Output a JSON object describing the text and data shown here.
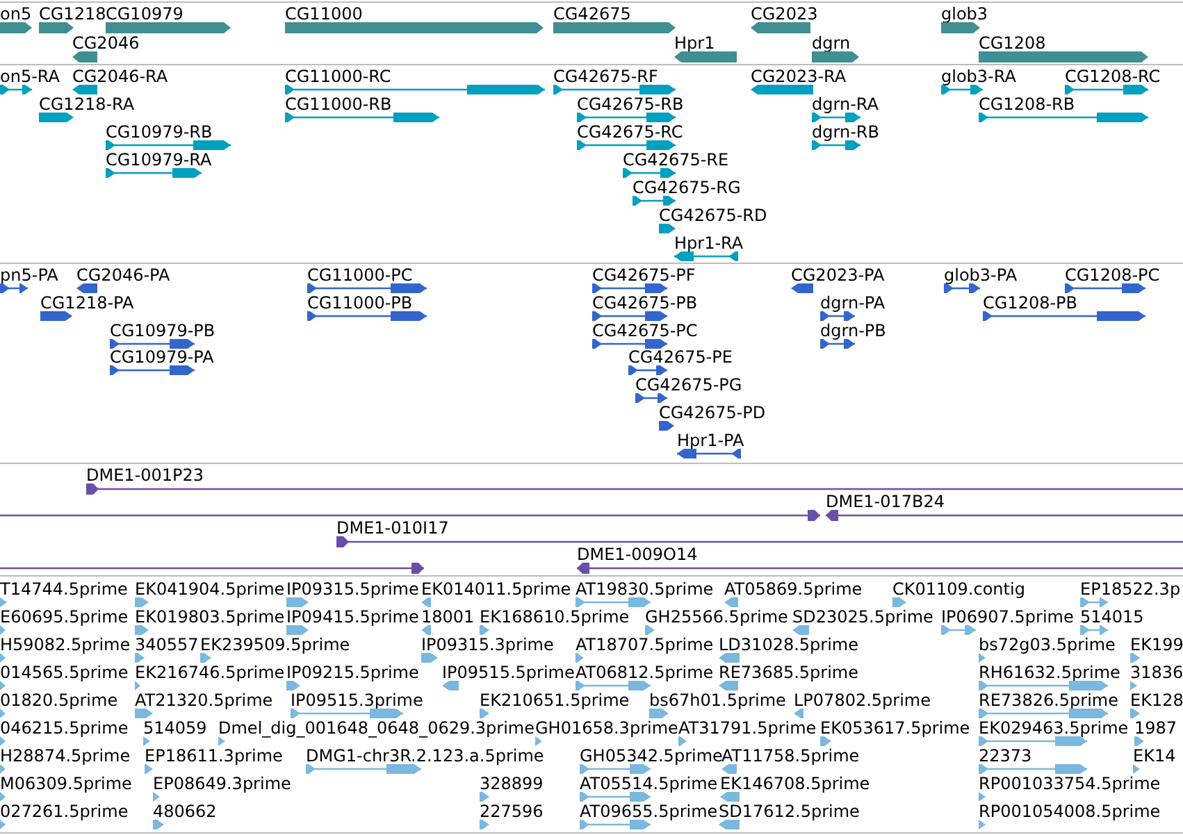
{
  "tracks": [
    {
      "kind": "gene",
      "features": [
        {
          "label": "on5",
          "reverse": false
        },
        {
          "label": "CG1218",
          "reverse": false
        },
        {
          "label": "CG10979",
          "reverse": false
        },
        {
          "label": "CG2046",
          "reverse": true
        },
        {
          "label": "CG11000",
          "reverse": false
        },
        {
          "label": "CG42675",
          "reverse": false
        },
        {
          "label": "Hpr1",
          "reverse": true
        },
        {
          "label": "CG2023",
          "reverse": true
        },
        {
          "label": "dgrn",
          "reverse": false
        },
        {
          "label": "glob3",
          "reverse": false
        },
        {
          "label": "CG1208",
          "reverse": false
        }
      ]
    },
    {
      "kind": "transcript",
      "features": [
        {
          "label": "on5-RA",
          "reverse": false
        },
        {
          "label": "CG2046-RA",
          "reverse": true
        },
        {
          "label": "CG1218-RA",
          "reverse": false
        },
        {
          "label": "CG10979-RB",
          "reverse": false
        },
        {
          "label": "CG10979-RA",
          "reverse": false
        },
        {
          "label": "CG11000-RC",
          "reverse": false
        },
        {
          "label": "CG11000-RB",
          "reverse": false
        },
        {
          "label": "CG42675-RF",
          "reverse": false
        },
        {
          "label": "CG42675-RB",
          "reverse": false
        },
        {
          "label": "CG42675-RC",
          "reverse": false
        },
        {
          "label": "CG42675-RE",
          "reverse": false
        },
        {
          "label": "CG42675-RG",
          "reverse": false
        },
        {
          "label": "CG42675-RD",
          "reverse": false
        },
        {
          "label": "Hpr1-RA",
          "reverse": true
        },
        {
          "label": "CG2023-RA",
          "reverse": true
        },
        {
          "label": "dgrn-RA",
          "reverse": false
        },
        {
          "label": "dgrn-RB",
          "reverse": false
        },
        {
          "label": "glob3-RA",
          "reverse": false
        },
        {
          "label": "CG1208-RC",
          "reverse": false
        },
        {
          "label": "CG1208-RB",
          "reverse": false
        }
      ]
    },
    {
      "kind": "protein",
      "features": [
        {
          "label": "pn5-PA",
          "reverse": false
        },
        {
          "label": "CG2046-PA",
          "reverse": true
        },
        {
          "label": "CG1218-PA",
          "reverse": false
        },
        {
          "label": "CG10979-PB",
          "reverse": false
        },
        {
          "label": "CG10979-PA",
          "reverse": false
        },
        {
          "label": "CG11000-PC",
          "reverse": false
        },
        {
          "label": "CG11000-PB",
          "reverse": false
        },
        {
          "label": "CG42675-PF",
          "reverse": false
        },
        {
          "label": "CG42675-PB",
          "reverse": false
        },
        {
          "label": "CG42675-PC",
          "reverse": false
        },
        {
          "label": "CG42675-PE",
          "reverse": false
        },
        {
          "label": "CG42675-PG",
          "reverse": false
        },
        {
          "label": "CG42675-PD",
          "reverse": false
        },
        {
          "label": "Hpr1-PA",
          "reverse": true
        },
        {
          "label": "CG2023-PA",
          "reverse": true
        },
        {
          "label": "dgrn-PA",
          "reverse": false
        },
        {
          "label": "dgrn-PB",
          "reverse": false
        },
        {
          "label": "glob3-PA",
          "reverse": false
        },
        {
          "label": "CG1208-PC",
          "reverse": false
        },
        {
          "label": "CG1208-PB",
          "reverse": false
        }
      ]
    },
    {
      "kind": "clone",
      "features": [
        {
          "label": "DME1-001P23",
          "reverse": false
        },
        {
          "reverse": false
        },
        {
          "label": "DME1-017B24",
          "reverse": true
        },
        {
          "label": "DME1-010I17",
          "reverse": false
        },
        {
          "reverse": false
        },
        {
          "label": "DME1-009O14",
          "reverse": true
        }
      ]
    },
    {
      "kind": "est",
      "features": [
        {
          "label": "T14744.5prime",
          "reverse": false
        },
        {
          "label": "EK041904.5prime",
          "reverse": false
        },
        {
          "label": "IP09315.5prime",
          "reverse": false
        },
        {
          "label": "EK014011.5prime",
          "reverse": true
        },
        {
          "label": "AT19830.5prime",
          "reverse": false
        },
        {
          "label": "AT05869.5prime",
          "reverse": true
        },
        {
          "label": "CK01109.contig",
          "reverse": false
        },
        {
          "label": "EP18522.3p",
          "reverse": false
        },
        {
          "label": "E60695.5prime",
          "reverse": false
        },
        {
          "label": "EK019803.5prime",
          "reverse": false
        },
        {
          "label": "IP09415.5prime",
          "reverse": false
        },
        {
          "label": "18001",
          "reverse": true
        },
        {
          "label": "EK168610.5prime",
          "reverse": false
        },
        {
          "label": "GH25566.5prime",
          "reverse": false
        },
        {
          "label": "SD23025.5prime",
          "reverse": true
        },
        {
          "label": "IP06907.5prime",
          "reverse": false
        },
        {
          "label": "514015",
          "reverse": false
        },
        {
          "label": "H59082.5prime",
          "reverse": false
        },
        {
          "label": "340557",
          "reverse": false
        },
        {
          "label": "EK239509.5prime",
          "reverse": false
        },
        {
          "label": "IP09315.3prime",
          "reverse": false
        },
        {
          "label": "AT18707.5prime",
          "reverse": false
        },
        {
          "label": "LD31028.5prime",
          "reverse": true
        },
        {
          "label": "bs72g03.5prime",
          "reverse": false
        },
        {
          "label": "EK199",
          "reverse": false
        },
        {
          "label": "014565.5prime",
          "reverse": false
        },
        {
          "label": "EK216746.5prime",
          "reverse": false
        },
        {
          "label": "IP09215.5prime",
          "reverse": false
        },
        {
          "label": "IP09515.5prime",
          "reverse": true
        },
        {
          "label": "AT06812.5prime",
          "reverse": false
        },
        {
          "label": "RE73685.5prime",
          "reverse": true
        },
        {
          "label": "RH61632.5prime",
          "reverse": false
        },
        {
          "label": "31836",
          "reverse": false
        },
        {
          "label": "01820.5prime",
          "reverse": false
        },
        {
          "label": "AT21320.5prime",
          "reverse": false
        },
        {
          "label": "IP09515.3prime",
          "reverse": false
        },
        {
          "label": "EK210651.5prime",
          "reverse": false
        },
        {
          "label": "bs67h01.5prime",
          "reverse": false
        },
        {
          "label": "LP07802.5prime",
          "reverse": true
        },
        {
          "label": "RE73826.5prime",
          "reverse": false
        },
        {
          "label": "EK128",
          "reverse": false
        },
        {
          "label": "046215.5prime",
          "reverse": false
        },
        {
          "label": "514059",
          "reverse": false
        },
        {
          "label": "Dmel_dig_001648_0648_0629.3prime",
          "reverse": false
        },
        {
          "label": "GH01658.3prime",
          "reverse": false
        },
        {
          "label": "AT31791.5prime",
          "reverse": false
        },
        {
          "label": "EK053617.5prime",
          "reverse": false
        },
        {
          "label": "EK029463.5prime",
          "reverse": false
        },
        {
          "label": "1987",
          "reverse": false
        },
        {
          "label": "H28874.5prime",
          "reverse": false
        },
        {
          "label": "EP18611.3prime",
          "reverse": false
        },
        {
          "label": "DMG1-chr3R.2.123.a.5prime",
          "reverse": false
        },
        {
          "label": "GH05342.5prime",
          "reverse": false
        },
        {
          "label": "AT11758.5prime",
          "reverse": true
        },
        {
          "label": "22373",
          "reverse": false
        },
        {
          "label": "EK14",
          "reverse": false
        },
        {
          "label": "M06309.5prime",
          "reverse": false
        },
        {
          "label": "EP08649.3prime",
          "reverse": false
        },
        {
          "label": "328899",
          "reverse": false
        },
        {
          "label": "AT05514.5prime",
          "reverse": false
        },
        {
          "label": "EK146708.5prime",
          "reverse": true
        },
        {
          "label": "RP001033754.5prime",
          "reverse": false
        },
        {
          "label": "027261.5prime",
          "reverse": false
        },
        {
          "label": "480662",
          "reverse": false
        },
        {
          "label": "227596",
          "reverse": false
        },
        {
          "label": "AT09655.5prime",
          "reverse": false
        },
        {
          "label": "SD17612.5prime",
          "reverse": true
        },
        {
          "label": "RP001054008.5prime",
          "reverse": false
        }
      ]
    }
  ]
}
